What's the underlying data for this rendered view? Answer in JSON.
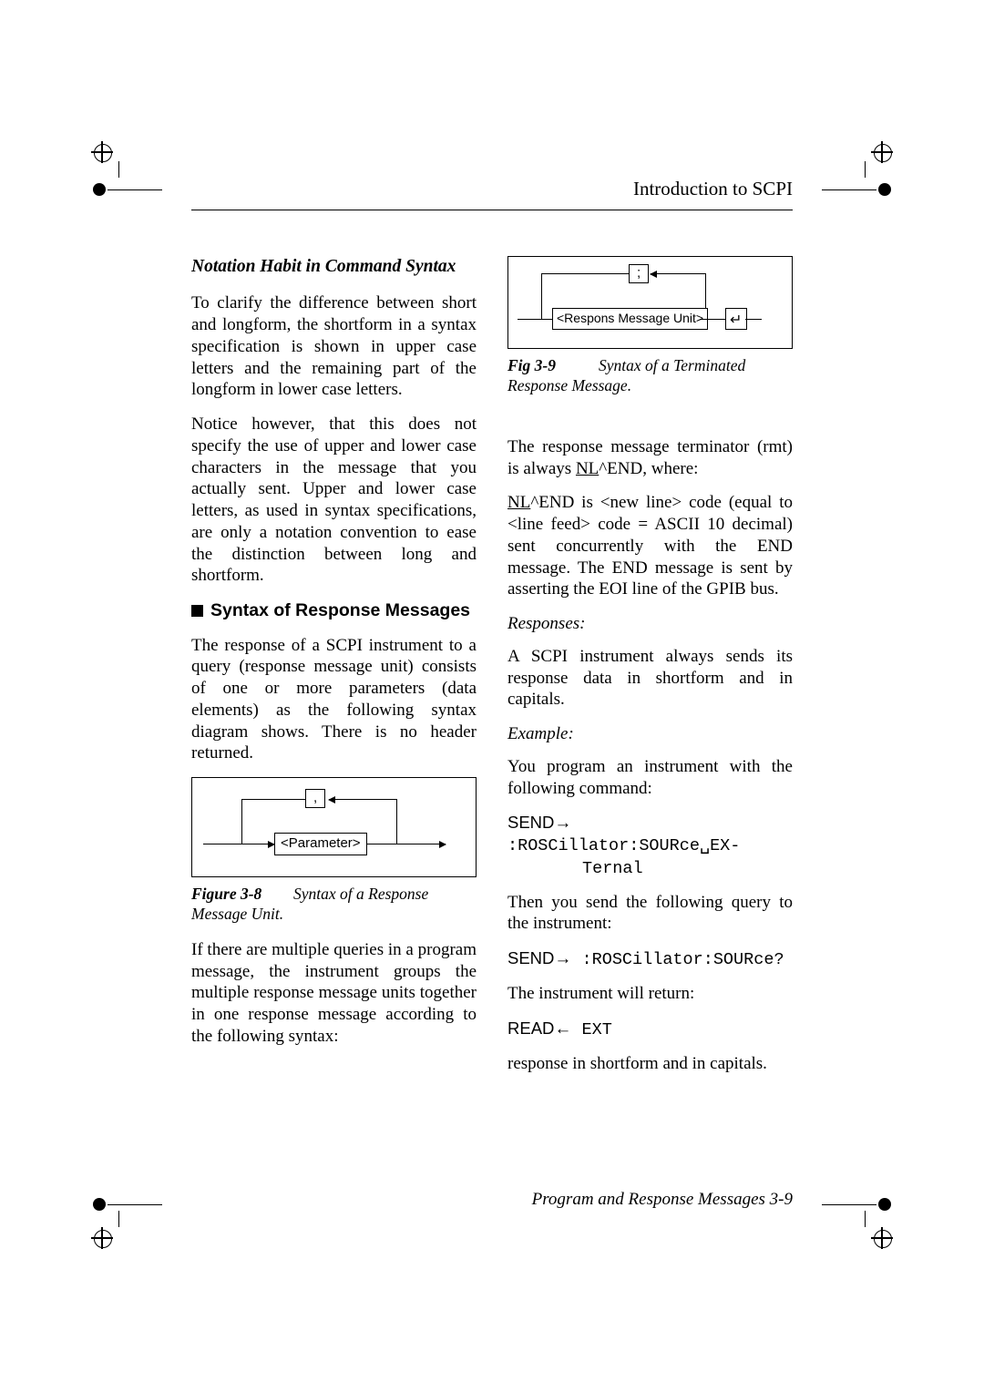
{
  "header": "Introduction to SCPI",
  "left": {
    "h1": "Notation Habit in Command Syntax",
    "p1": "To clarify the difference between short and longform, the shortform in a syntax specification is shown in upper case letters and the remaining part of the longform in lower case letters.",
    "p2": "Notice however, that this does not specify the use of upper and lower case characters in the message that you actually sent. Upper and lower case letters, as used in syntax specifications, are only a notation convention to ease the distinction between long and shortform.",
    "h2": "Syntax of Response Messages",
    "p3": "The response of a SCPI instrument to a query (response message unit) consists of one or more parameters (data elements) as the following syntax diagram shows. There is no header returned.",
    "fig1_num": "Figure 3-8",
    "fig1_title": "Syntax of a Response Message Unit.",
    "fig1_node_comma": ",",
    "fig1_node_param": "<Parameter>",
    "p4": "If there are multiple queries in a  program message, the instrument groups the multiple response message units together in one response message according to the following syntax:"
  },
  "right": {
    "fig2_node_semi": ";",
    "fig2_node_unit": "<Respons Message Unit>",
    "fig2_num": "Fig 3-9",
    "fig2_title": "Syntax of a Terminated Response Message.",
    "p1a": "The response message terminator (rmt) is always ",
    "p1b": "NL",
    "p1c": "^END, where:",
    "p2a": "NL",
    "p2b": "^END is <new line> code (equal to <line feed> code = ASCII 10 decimal) sent concurrently with the END message. The END message is sent by asserting the EOI line of the GPIB bus.",
    "h1": "Responses:",
    "p3": "A SCPI instrument always sends its response data in shortform and in capitals.",
    "h2": "Example:",
    "p4": "You program an instrument with the following command:",
    "cmd1_label": "SEND",
    "cmd1_arrow": "→",
    "cmd1_body": " :ROSCillator:SOURce␣EX-",
    "cmd1_body2": "Ternal",
    "p5": "Then you send the following query to the instrument:",
    "cmd2_label": "SEND",
    "cmd2_arrow": "→",
    "cmd2_body": " :ROSCillator:SOURce?",
    "p6": "The instrument will return:",
    "cmd3_label": "READ",
    "cmd3_arrow": "←",
    "cmd3_body": " EXT",
    "p7": "response in shortform and in capitals."
  },
  "footer": "Program and Response Messages 3-9"
}
